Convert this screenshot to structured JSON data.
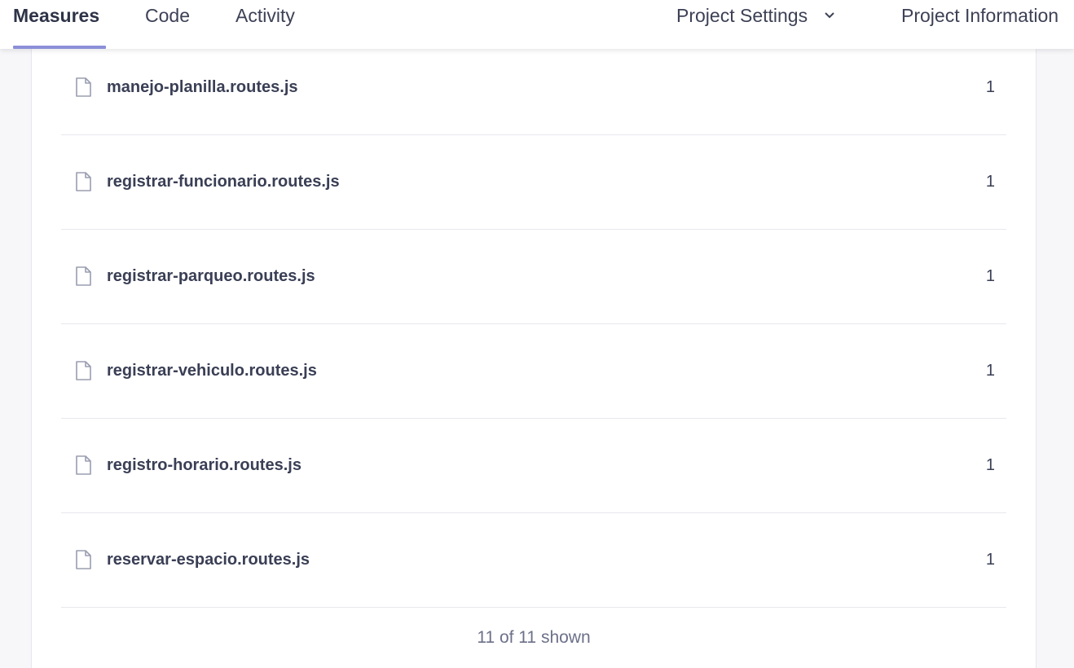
{
  "nav": {
    "tabs": [
      {
        "label": "Measures"
      },
      {
        "label": "Code"
      },
      {
        "label": "Activity"
      }
    ],
    "project_settings": "Project Settings",
    "project_information": "Project Information"
  },
  "files": [
    {
      "name": "manejo-planilla.routes.js",
      "value": "1"
    },
    {
      "name": "registrar-funcionario.routes.js",
      "value": "1"
    },
    {
      "name": "registrar-parqueo.routes.js",
      "value": "1"
    },
    {
      "name": "registrar-vehiculo.routes.js",
      "value": "1"
    },
    {
      "name": "registro-horario.routes.js",
      "value": "1"
    },
    {
      "name": "reservar-espacio.routes.js",
      "value": "1"
    }
  ],
  "footer": {
    "shown": "11 of 11 shown"
  },
  "colors": {
    "accent": "#8b8fd9",
    "text": "#3a3f55",
    "muted": "#6c7089"
  }
}
